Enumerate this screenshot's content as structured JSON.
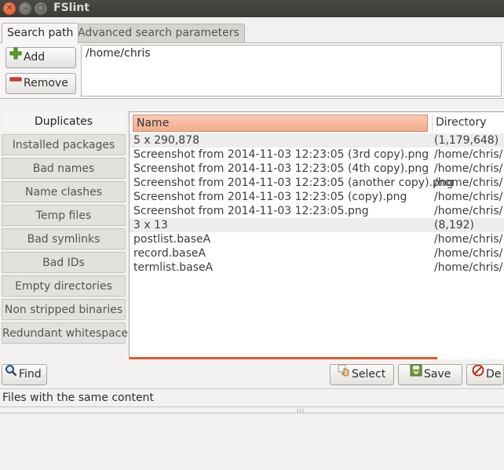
{
  "window": {
    "title": "FSlint"
  },
  "tabs": [
    {
      "label": "Search path"
    },
    {
      "label": "Advanced search parameters"
    }
  ],
  "search_path": {
    "add_label": "Add",
    "remove_label": "Remove",
    "paths": [
      "/home/chris"
    ]
  },
  "sidebar": {
    "items": [
      {
        "label": "Duplicates"
      },
      {
        "label": "Installed packages"
      },
      {
        "label": "Bad names"
      },
      {
        "label": "Name clashes"
      },
      {
        "label": "Temp files"
      },
      {
        "label": "Bad symlinks"
      },
      {
        "label": "Bad IDs"
      },
      {
        "label": "Empty directories"
      },
      {
        "label": "Non stripped binaries"
      },
      {
        "label": "Redundant whitespace"
      }
    ]
  },
  "results": {
    "columns": {
      "name": "Name",
      "directory": "Directory"
    },
    "rows": [
      {
        "name": "5 x 290,878",
        "directory": "(1,179,648)"
      },
      {
        "name": "Screenshot from 2014-11-03 12:23:05 (3rd copy).png",
        "directory": "/home/chris/"
      },
      {
        "name": "Screenshot from 2014-11-03 12:23:05 (4th copy).png",
        "directory": "/home/chris/"
      },
      {
        "name": "Screenshot from 2014-11-03 12:23:05 (another copy).png",
        "directory": "/home/chris/"
      },
      {
        "name": "Screenshot from 2014-11-03 12:23:05 (copy).png",
        "directory": "/home/chris/"
      },
      {
        "name": "Screenshot from 2014-11-03 12:23:05.png",
        "directory": "/home/chris/"
      },
      {
        "name": "3 x 13",
        "directory": "(8,192)"
      },
      {
        "name": "postlist.baseA",
        "directory": "/home/chris/"
      },
      {
        "name": "record.baseA",
        "directory": "/home/chris/"
      },
      {
        "name": "termlist.baseA",
        "directory": "/home/chris/"
      }
    ]
  },
  "toolbar": {
    "find_label": "Find",
    "select_label": "Select",
    "save_label": "Save",
    "delete_label": "De"
  },
  "status": {
    "text": "Files with the same content"
  },
  "colors": {
    "accent": "#e05a2a",
    "header_highlight": "#f1ad8f"
  }
}
